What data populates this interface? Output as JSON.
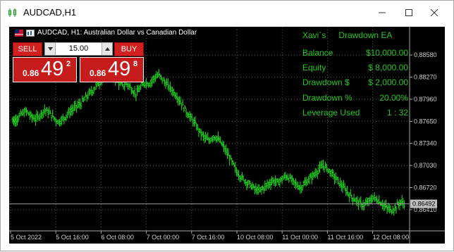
{
  "window": {
    "title": "AUDCAD,H1",
    "icon": "chart-candles-icon",
    "controls": [
      "minimize-icon",
      "maximize-icon",
      "close-icon"
    ]
  },
  "chart": {
    "header_text": "AUDCAD, H1:  Australian Dollar vs Canadian Dollar",
    "current_price": "0.86492",
    "colors": {
      "background": "#000000",
      "bars": "#1fdc1f",
      "grid": "#5a5a5a",
      "axis_text": "#d0d0d0",
      "price_tag": "#c0c0c0"
    }
  },
  "trade_panel": {
    "sell_label": "SELL",
    "buy_label": "BUY",
    "lot_value": "15.00",
    "sell_quote": {
      "small": "0.86",
      "big": "49",
      "sup": "2"
    },
    "buy_quote": {
      "small": "0.86",
      "big": "49",
      "sup": "8"
    },
    "color": "#c71c1c"
  },
  "ea_panel": {
    "title_left": "Xavi`s",
    "title_right": "Drawdown EA",
    "rows": [
      {
        "label": "Balance",
        "value": "$10,000.00"
      },
      {
        "label": "Equity",
        "value": "$ 8,000.00"
      },
      {
        "label": "Drawdown $",
        "value": "$ 2,000.00"
      },
      {
        "label": "Drawdown %",
        "value": "20.00%"
      },
      {
        "label": "Leverage Used",
        "value": "1 : 32"
      }
    ],
    "color": "#22c81c"
  },
  "chart_data": {
    "type": "line",
    "title": "AUDCAD, H1:  Australian Dollar vs Canadian Dollar",
    "xlabel": "",
    "ylabel": "",
    "x_tick_labels": [
      "5 Oct 2022",
      "5 Oct 16:00",
      "6 Oct 08:00",
      "7 Oct 00:00",
      "7 Oct 16:00",
      "10 Oct 08:00",
      "11 Oct 00:00",
      "11 Oct 16:00",
      "12 Oct 08:00"
    ],
    "y_tick_labels": [
      "0.88580",
      "0.88270",
      "0.87960",
      "0.87650",
      "0.87340",
      "0.87030",
      "0.86720",
      "0.86410"
    ],
    "ylim": [
      0.863,
      0.8875
    ],
    "grid": true,
    "series": [
      {
        "values": [
          0.8766,
          0.877,
          0.8775,
          0.8779,
          0.8772,
          0.8768,
          0.8774,
          0.8781,
          0.8777,
          0.877,
          0.8764,
          0.8768,
          0.8775,
          0.8781,
          0.8786,
          0.879,
          0.8798,
          0.8805,
          0.8812,
          0.882,
          0.8827,
          0.8832,
          0.8829,
          0.8821,
          0.8815,
          0.8818,
          0.8811,
          0.8803,
          0.8812,
          0.882,
          0.8818,
          0.8826,
          0.883,
          0.8822,
          0.8815,
          0.8808,
          0.88,
          0.879,
          0.8779,
          0.877,
          0.8761,
          0.875,
          0.8742,
          0.8738,
          0.8744,
          0.874,
          0.8731,
          0.872,
          0.8708,
          0.8695,
          0.8687,
          0.8681,
          0.8676,
          0.867,
          0.8667,
          0.8672,
          0.8677,
          0.8682,
          0.8679,
          0.8684,
          0.8688,
          0.8683,
          0.8677,
          0.8672,
          0.8677,
          0.8684,
          0.869,
          0.8697,
          0.8703,
          0.8698,
          0.8691,
          0.8683,
          0.8675,
          0.8668,
          0.866,
          0.8655,
          0.865,
          0.8647,
          0.8652,
          0.8658,
          0.8654,
          0.8649,
          0.8643,
          0.864,
          0.8645,
          0.8652,
          0.8649
        ]
      }
    ]
  }
}
